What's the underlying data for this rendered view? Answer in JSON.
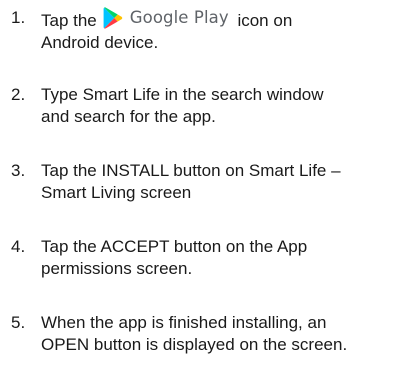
{
  "steps": [
    {
      "number": "1.",
      "before_icon": "Tap the",
      "icon": "google-play-logo-icon",
      "icon_label": "Google Play",
      "after_icon": "icon on",
      "line2": "Android device."
    },
    {
      "number": "2.",
      "line1": "Type Smart Life in the search window",
      "line2": "and search for the app."
    },
    {
      "number": "3.",
      "line1": "Tap the INSTALL button on  Smart Life –",
      "line2": "Smart Living screen"
    },
    {
      "number": "4.",
      "line1": "Tap the ACCEPT button on the App",
      "line2": "permissions screen."
    },
    {
      "number": "5.",
      "line1": "When the app is finished installing, an",
      "line2": "OPEN button is displayed on the screen."
    }
  ],
  "colors": {
    "text": "#1a1a1a",
    "google_play_label": "#5f6368",
    "play_green": "#01D46C",
    "play_blue": "#00C3FF",
    "play_yellow": "#FFC200",
    "play_red": "#FF3A44"
  }
}
